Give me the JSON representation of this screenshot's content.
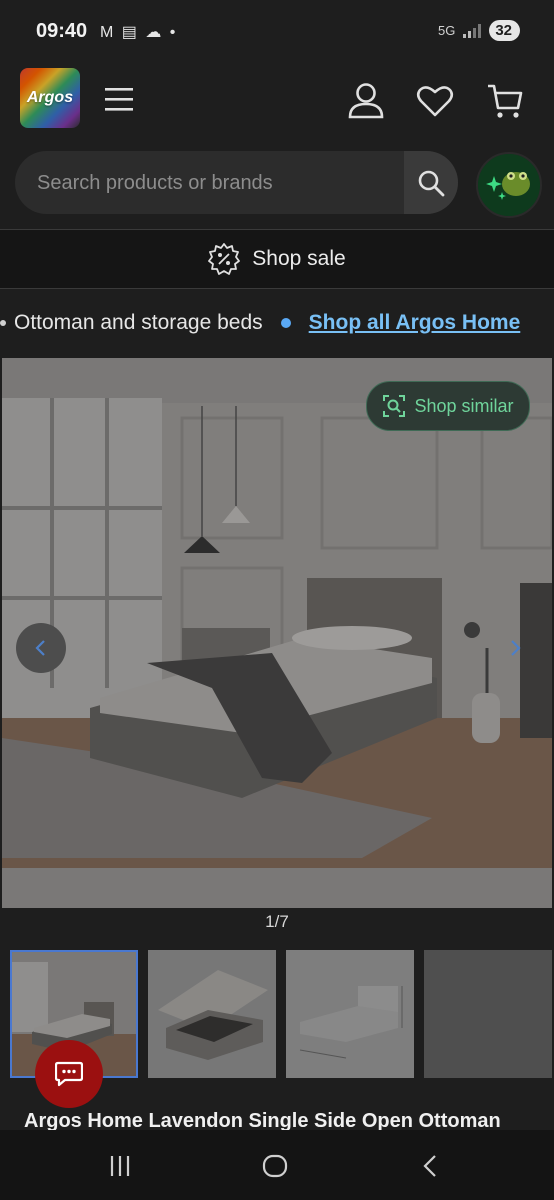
{
  "status": {
    "time": "09:40",
    "icons": "M ▤ ☁ •",
    "network": "5G",
    "battery": "32"
  },
  "header": {
    "logo_text": "Argos",
    "search_placeholder": "Search products or brands"
  },
  "sale": {
    "label": "Shop sale"
  },
  "breadcrumb": {
    "current": "Ottoman and storage beds",
    "link": "Shop all Argos Home"
  },
  "gallery": {
    "shop_similar_label": "Shop similar",
    "counter": "1/7"
  },
  "product": {
    "title": "Argos Home Lavendon Single Side Open Ottoman"
  },
  "colors": {
    "background": "#1e1e1e",
    "accent_link": "#79c0f5",
    "similar_green": "#6fd49b",
    "chat_red": "#9b1010",
    "selected_thumb": "#4a78d0"
  }
}
